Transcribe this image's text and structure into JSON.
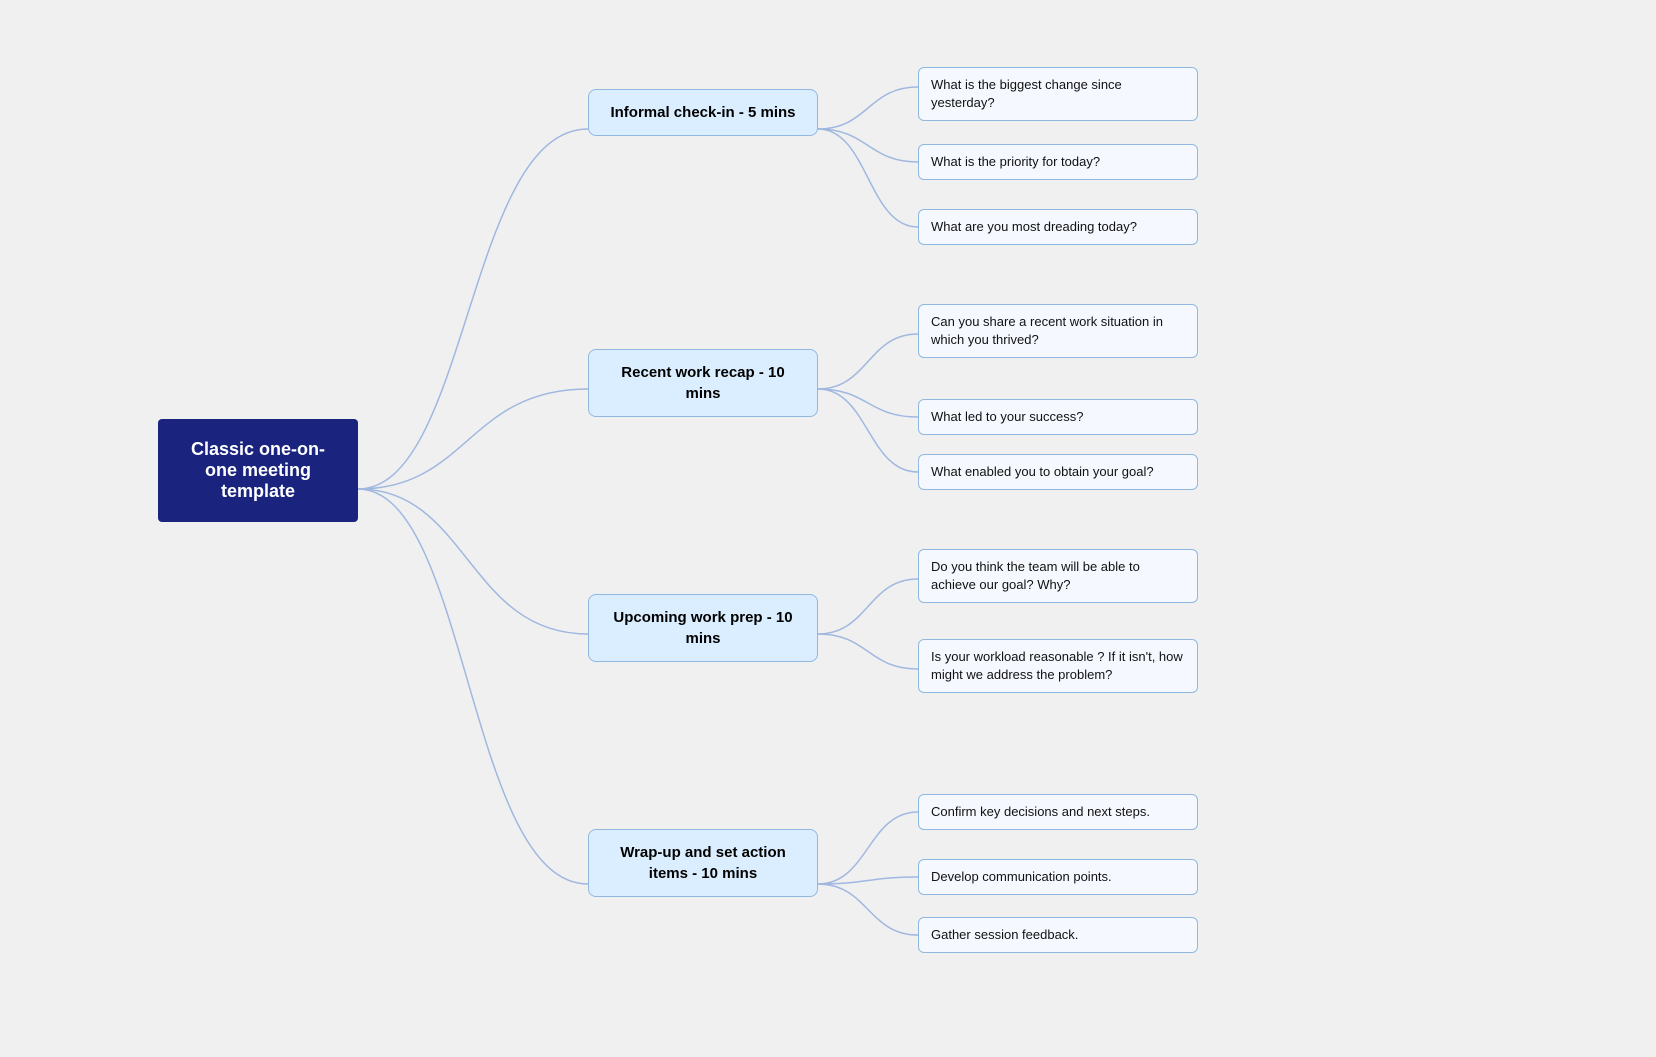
{
  "root": {
    "label": "Classic one-on-one meeting template"
  },
  "branches": [
    {
      "id": "b1",
      "label": "Informal check-in - 5 mins",
      "leaves": [
        "What is the biggest change since yesterday?",
        "What is the priority for today?",
        "What are you most dreading today?"
      ]
    },
    {
      "id": "b2",
      "label": "Recent work recap - 10 mins",
      "leaves": [
        "Can you share a recent work situation in which you thrived?",
        "What led to your success?",
        "What enabled you to obtain your goal?"
      ]
    },
    {
      "id": "b3",
      "label": "Upcoming work prep - 10 mins",
      "leaves": [
        "Do you think the team will be able to achieve our goal?  Why?",
        "Is your workload reasonable ? If it isn't, how might we address the problem?"
      ]
    },
    {
      "id": "b4",
      "label": "Wrap-up and set action items - 10 mins",
      "leaves": [
        "Confirm key decisions and next steps.",
        "Develop communication points.",
        "Gather session feedback."
      ]
    }
  ]
}
